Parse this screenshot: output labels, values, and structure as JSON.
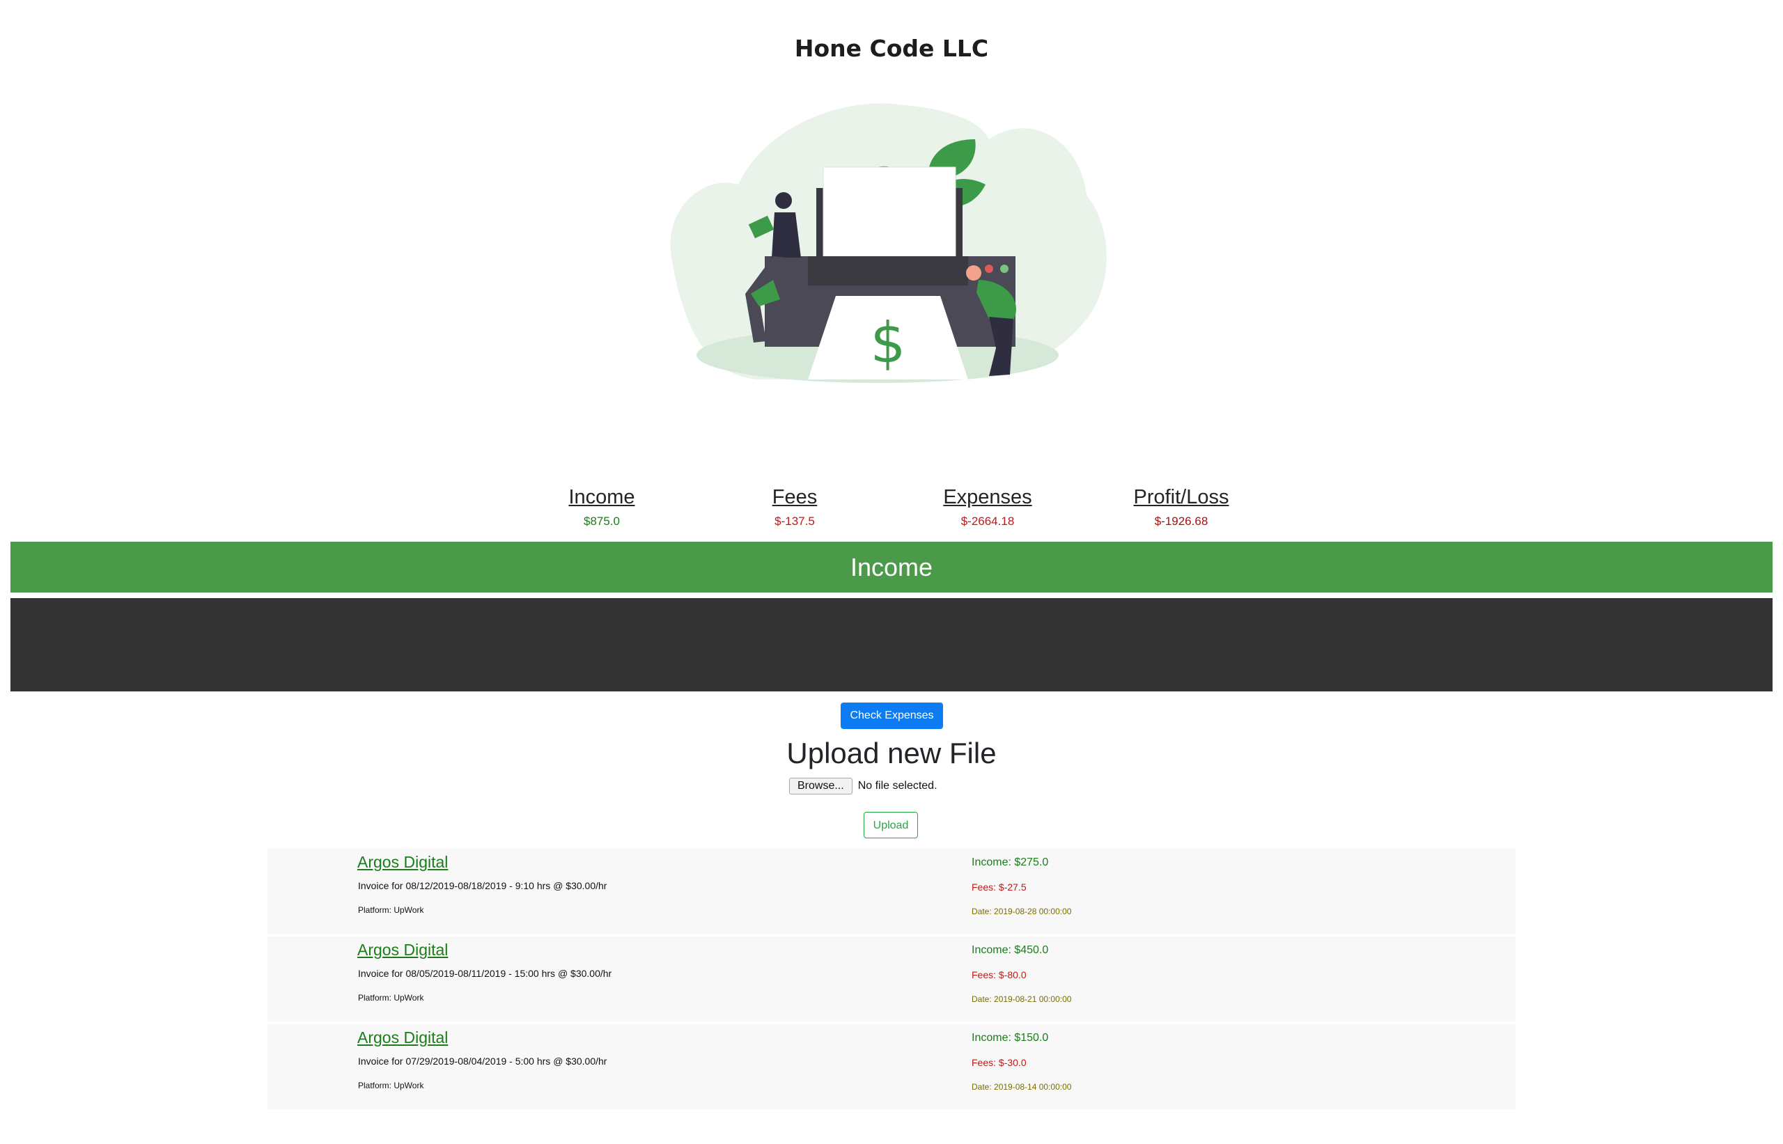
{
  "brand": {
    "title": "Hone Code LLC"
  },
  "colors": {
    "positive": "#1a7d1a",
    "negative": "#c01818",
    "date": "#7a6d00",
    "income_bar": "#4a9a4a",
    "dark_bar": "#333333",
    "primary_button": "#0d7cf2",
    "upload_button": "#28a745"
  },
  "illustration": {
    "icon": "dollar-sign-illustration",
    "symbol": "$"
  },
  "summary": [
    {
      "label": "Income",
      "value": "$875.0",
      "tone": "positive"
    },
    {
      "label": "Fees",
      "value": "$-137.5",
      "tone": "negative"
    },
    {
      "label": "Expenses",
      "value": "$-2664.18",
      "tone": "negative"
    },
    {
      "label": "Profit/Loss",
      "value": "$-1926.68",
      "tone": "negative"
    }
  ],
  "income_section": {
    "title": "Income"
  },
  "actions": {
    "check_expenses": "Check Expenses"
  },
  "upload": {
    "title": "Upload new File",
    "browse_label": "Browse...",
    "no_file_text": "No file selected.",
    "upload_label": "Upload"
  },
  "invoices": [
    {
      "client": "Argos Digital",
      "description": "Invoice for 08/12/2019-08/18/2019 - 9:10 hrs @ $30.00/hr",
      "platform": "Platform: UpWork",
      "income": "Income: $275.0",
      "fees": "Fees: $-27.5",
      "date": "Date: 2019-08-28 00:00:00"
    },
    {
      "client": "Argos Digital",
      "description": "Invoice for 08/05/2019-08/11/2019 - 15:00 hrs @ $30.00/hr",
      "platform": "Platform: UpWork",
      "income": "Income: $450.0",
      "fees": "Fees: $-80.0",
      "date": "Date: 2019-08-21 00:00:00"
    },
    {
      "client": "Argos Digital",
      "description": "Invoice for 07/29/2019-08/04/2019 - 5:00 hrs @ $30.00/hr",
      "platform": "Platform: UpWork",
      "income": "Income: $150.0",
      "fees": "Fees: $-30.0",
      "date": "Date: 2019-08-14 00:00:00"
    }
  ]
}
